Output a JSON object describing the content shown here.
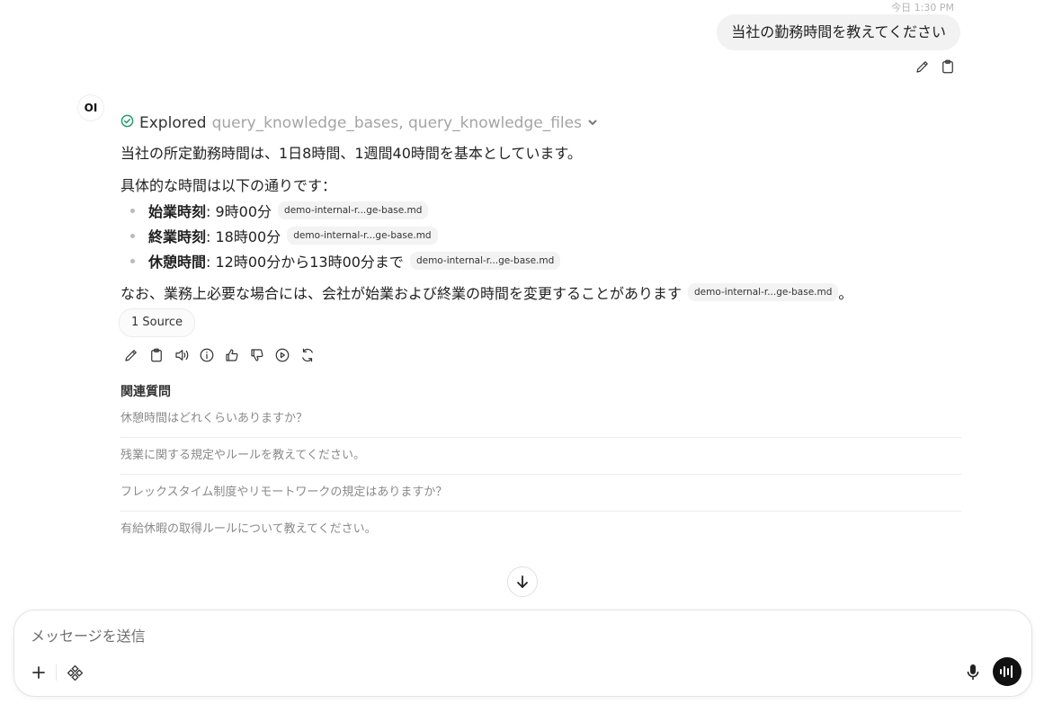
{
  "user_message": {
    "timestamp": "今日 1:30 PM",
    "text": "当社の勤務時間を教えてください",
    "actions": [
      "edit-icon",
      "clipboard-icon"
    ]
  },
  "assistant": {
    "avatar_label": "OI",
    "explored": {
      "status_icon": "check-circle-icon",
      "verb": "Explored",
      "tools": "query_knowledge_bases, query_knowledge_files"
    },
    "paragraph_1": "当社の所定勤務時間は、1日8時間、1週間40時間を基本としています。",
    "paragraph_2": "具体的な時間は以下の通りです：",
    "bullets": [
      {
        "term": "始業時刻",
        "value": ": 9時00分",
        "citation": "demo-internal-r...ge-base.md"
      },
      {
        "term": "終業時刻",
        "value": ": 18時00分",
        "citation": "demo-internal-r...ge-base.md"
      },
      {
        "term": "休憩時間",
        "value": ": 12時00分から13時00分まで",
        "citation": "demo-internal-r...ge-base.md"
      }
    ],
    "paragraph_3": "なお、業務上必要な場合には、会社が始業および終業の時間を変更することがあります",
    "paragraph_3_citation": "demo-internal-r...ge-base.md",
    "paragraph_3_end": "。",
    "source_button": "1 Source",
    "response_actions": [
      "edit-icon",
      "clipboard-icon",
      "speaker-icon",
      "info-icon",
      "thumbs-up-icon",
      "thumbs-down-icon",
      "play-icon",
      "regenerate-icon"
    ]
  },
  "related": {
    "title": "関連質問",
    "items": [
      "休憩時間はどれくらいありますか？",
      "残業に関する規定やルールを教えてください。",
      "フレックスタイム制度やリモートワークの規定はありますか？",
      "有給休暇の取得ルールについて教えてください。"
    ]
  },
  "composer": {
    "placeholder": "メッセージを送信",
    "left_icons": [
      "plus-icon",
      "tools-icon"
    ],
    "right_icons": [
      "microphone-icon",
      "voice-mode-icon"
    ]
  },
  "colors": {
    "accent_green": "#22a06b",
    "bubble_bg": "#f2f2f2",
    "voice_button_bg": "#111111"
  }
}
